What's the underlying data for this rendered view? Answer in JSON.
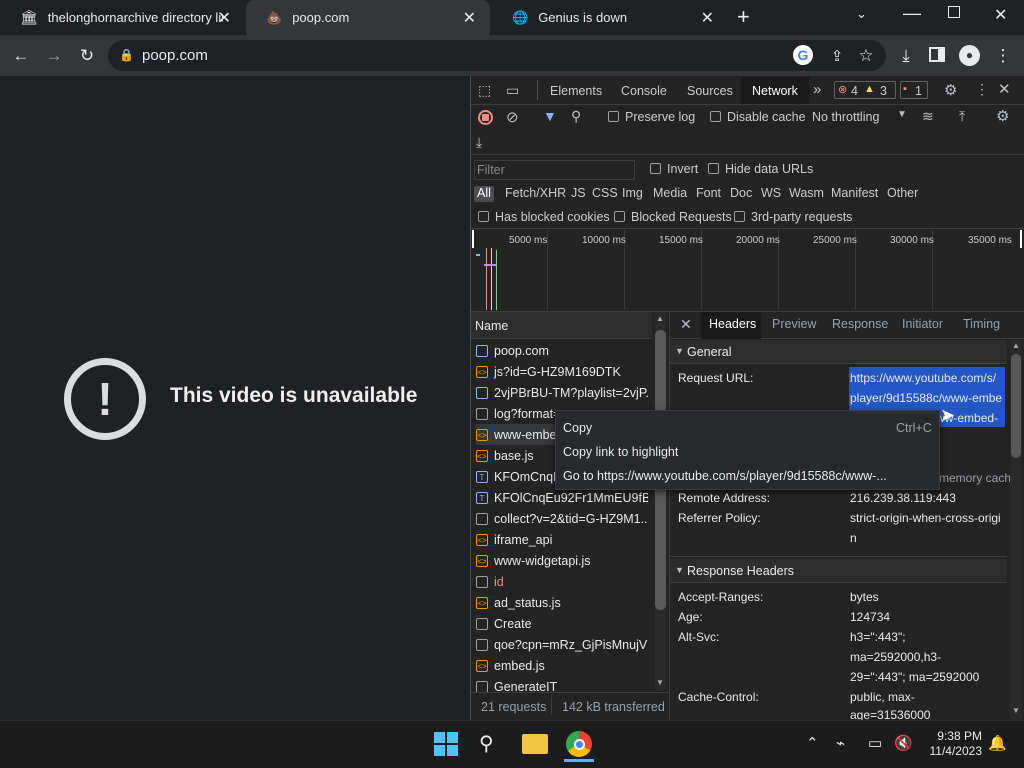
{
  "tabs": [
    {
      "title": "thelonghornarchive directory listing",
      "icon": "columns-icon"
    },
    {
      "title": "poop.com",
      "icon": "poop-emoji-icon"
    },
    {
      "title": "Genius is down",
      "icon": "globe-icon"
    }
  ],
  "toolbar": {
    "url": "poop.com"
  },
  "page": {
    "message": "This video is unavailable",
    "icon_glyph": "!"
  },
  "devtools": {
    "tabs": [
      "Elements",
      "Console",
      "Sources",
      "Network"
    ],
    "active_tab": "Network",
    "more": "»",
    "errors": "4",
    "warnings": "3",
    "issues": "1",
    "preserve_log": "Preserve log",
    "disable_cache": "Disable cache",
    "throttling": "No throttling",
    "filter_placeholder": "Filter",
    "invert": "Invert",
    "hide_data_urls": "Hide data URLs",
    "type_filters": [
      "All",
      "Fetch/XHR",
      "JS",
      "CSS",
      "Img",
      "Media",
      "Font",
      "Doc",
      "WS",
      "Wasm",
      "Manifest",
      "Other"
    ],
    "blocked_cookies": "Has blocked cookies",
    "blocked_requests": "Blocked Requests",
    "third_party": "3rd-party requests",
    "timeline_ticks": [
      "5000 ms",
      "10000 ms",
      "15000 ms",
      "20000 ms",
      "25000 ms",
      "30000 ms",
      "35000 ms"
    ],
    "name_header": "Name",
    "requests": [
      {
        "name": "poop.com",
        "type": "doc"
      },
      {
        "name": "js?id=G-HZ9M169DTK",
        "type": "js"
      },
      {
        "name": "2vjPBrBU-TM?playlist=2vjP...",
        "type": "doc"
      },
      {
        "name": "log?format=",
        "type": "other"
      },
      {
        "name": "www-embed-",
        "type": "js"
      },
      {
        "name": "base.js",
        "type": "js"
      },
      {
        "name": "KFOmCnqEu",
        "type": "font"
      },
      {
        "name": "KFOlCnqEu92Fr1MmEU9fB...",
        "type": "font"
      },
      {
        "name": "collect?v=2&tid=G-HZ9M1...",
        "type": "other"
      },
      {
        "name": "iframe_api",
        "type": "js"
      },
      {
        "name": "www-widgetapi.js",
        "type": "js"
      },
      {
        "name": "id",
        "type": "other",
        "error": true
      },
      {
        "name": "ad_status.js",
        "type": "js"
      },
      {
        "name": "Create",
        "type": "other"
      },
      {
        "name": "qoe?cpn=mRz_GjPisMnujVl...",
        "type": "other"
      },
      {
        "name": "embed.js",
        "type": "js"
      },
      {
        "name": "GenerateIT",
        "type": "other"
      }
    ],
    "summary_requests": "21 requests",
    "summary_transferred": "142 kB transferred",
    "detail_tabs": [
      "Headers",
      "Preview",
      "Response",
      "Initiator",
      "Timing"
    ],
    "active_detail_tab": "Headers",
    "general_title": "General",
    "request_url_label": "Request URL:",
    "request_url_lines": [
      "https://www.youtube.com/s/",
      "player/9d15588c/www-embe",
      "d-player.vflset/www-embed-"
    ],
    "memory_cache": "(memory cache)",
    "remote_address_label": "Remote Address:",
    "remote_address": "216.239.38.119:443",
    "referrer_policy_label": "Referrer Policy:",
    "referrer_policy_lines": [
      "strict-origin-when-cross-origi",
      "n"
    ],
    "response_headers_title": "Response Headers",
    "response_headers": [
      {
        "key": "Accept-Ranges:",
        "lines": [
          "bytes"
        ]
      },
      {
        "key": "Age:",
        "lines": [
          "124734"
        ]
      },
      {
        "key": "Alt-Svc:",
        "lines": [
          "h3=\":443\";",
          "ma=2592000,h3-",
          "29=\":443\"; ma=2592000"
        ]
      },
      {
        "key": "Cache-Control:",
        "lines": [
          "public, max-",
          "age=31536000"
        ]
      }
    ]
  },
  "context_menu": {
    "copy": "Copy",
    "copy_shortcut": "Ctrl+C",
    "copy_link": "Copy link to highlight",
    "goto": "Go to https://www.youtube.com/s/player/9d15588c/www-..."
  },
  "taskbar": {
    "time": "9:38 PM",
    "date": "11/4/2023"
  },
  "colors": {
    "accent": "#8ab4f8",
    "error_red": "#f28b82",
    "warning_orange": "#fdd663",
    "selection": "#2457c5"
  }
}
